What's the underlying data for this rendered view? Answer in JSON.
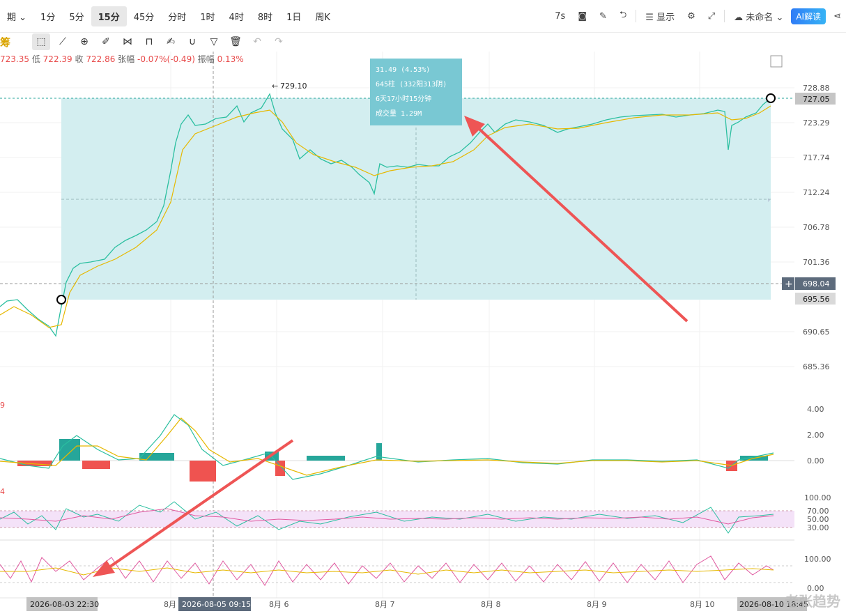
{
  "toolbar": {
    "period_label": "期",
    "intervals": [
      "1分",
      "5分",
      "15分",
      "45分",
      "分时",
      "1时",
      "4时",
      "8时",
      "1日",
      "周K"
    ],
    "active_interval": "15分",
    "right": {
      "seconds": "7s",
      "display_label": "显示",
      "name_label": "未命名",
      "ai_label": "AI解读"
    }
  },
  "brand_glyph": "筹",
  "ohlc": {
    "open_value": "723.35",
    "low_label": "低",
    "low_value": "722.39",
    "close_label": "收",
    "close_value": "722.86",
    "change_label": "张幅",
    "change_value": "-0.07%(-0.49)",
    "amp_label": "振幅",
    "amp_value": "0.13%"
  },
  "price_axis": {
    "ticks": [
      "728.88",
      "723.29",
      "717.74",
      "712.24",
      "706.78",
      "701.36",
      "690.65",
      "685.36"
    ]
  },
  "price_tags": {
    "current": "727.05",
    "cursor": "698.04",
    "low_box": "695.56"
  },
  "peak_label": "729.10",
  "measure_box": {
    "line1": "31.49 (4.53%)",
    "line2": "645柱 (332阳313阴)",
    "line3": "6天17小时15分钟",
    "line4": "成交量 1.29M"
  },
  "macd": {
    "label": "9",
    "ticks": [
      "4.00",
      "2.00",
      "0.00"
    ]
  },
  "rsi": {
    "label": "4",
    "ticks": [
      "100.00",
      "70.00",
      "50.00",
      "30.00"
    ]
  },
  "kdj": {
    "ticks": [
      "100.00",
      "0.00"
    ]
  },
  "time_axis": {
    "labels": [
      "8月",
      "8月 6",
      "8月 7",
      "8月 8",
      "8月 9",
      "8月 10"
    ],
    "start_tag": "2026-08-03 22:30",
    "cursor_tag": "2026-08-05 09:15",
    "end_tag": "2026-08-10 18:45"
  },
  "watermark": "老张趋势",
  "colors": {
    "up": "#26a69a",
    "down": "#ef5350",
    "box": "#d3eef0",
    "arrow": "#ee5555",
    "ma_yellow": "#e6b800"
  }
}
